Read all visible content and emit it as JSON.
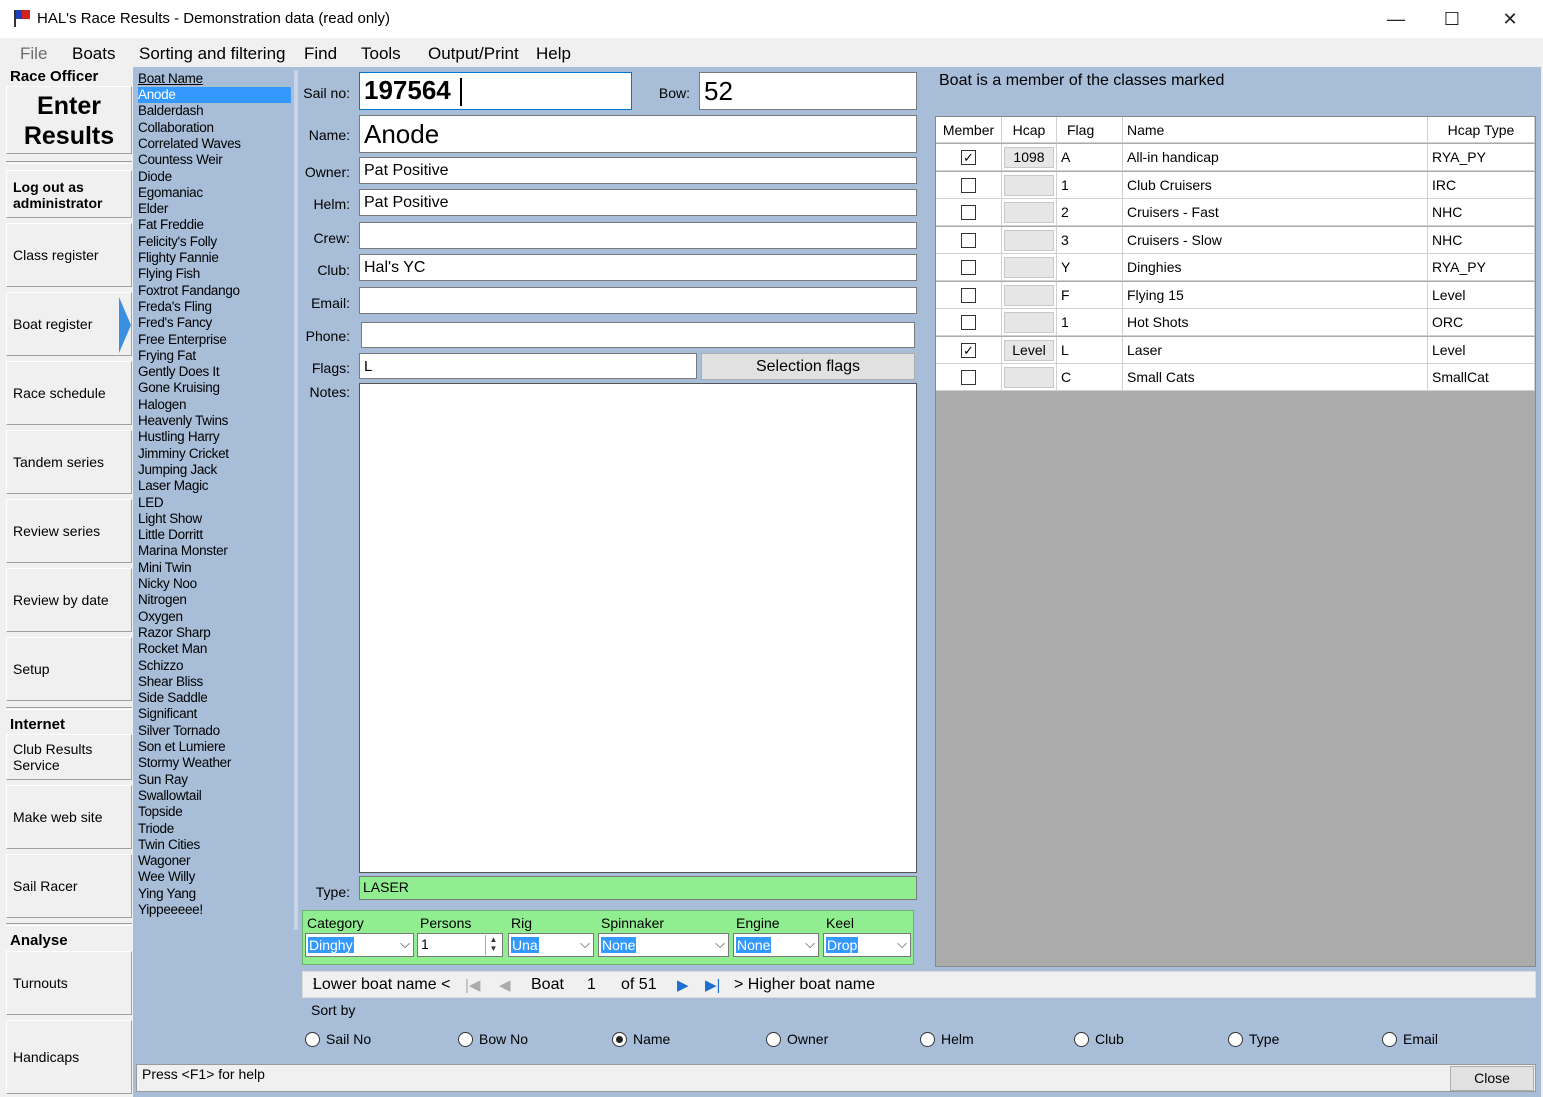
{
  "window": {
    "title": "HAL's Race Results - Demonstration data (read only)",
    "minimize": "—",
    "maximize": "☐",
    "close": "✕"
  },
  "menu": {
    "file": "File",
    "boats": "Boats",
    "sorting": "Sorting and filtering",
    "find": "Find",
    "tools": "Tools",
    "output": "Output/Print",
    "help": "Help"
  },
  "nav": {
    "race_officer": "Race Officer",
    "enter_results_1": "Enter",
    "enter_results_2": "Results",
    "logout_1": "Log out as",
    "logout_2": "administrator",
    "class_register": "Class register",
    "boat_register": "Boat register",
    "race_schedule": "Race schedule",
    "tandem_series": "Tandem series",
    "review_series": "Review series",
    "review_by_date": "Review by date",
    "setup": "Setup",
    "internet": "Internet",
    "club_results_1": "Club Results",
    "club_results_2": "Service",
    "make_web_site": "Make web site",
    "sail_racer": "Sail Racer",
    "analyse": "Analyse",
    "turnouts": "Turnouts",
    "handicaps": "Handicaps"
  },
  "boat_list": {
    "header": "Boat Name",
    "selected": "Anode",
    "items": [
      "Anode",
      "Balderdash",
      "Collaboration",
      "Correlated Waves",
      "Countess Weir",
      "Diode",
      "Egomaniac",
      "Elder",
      "Fat Freddie",
      "Felicity's Folly",
      "Flighty Fannie",
      "Flying Fish",
      "Foxtrot Fandango",
      "Freda's Fling",
      "Fred's Fancy",
      "Free Enterprise",
      "Frying Fat",
      "Gently Does It",
      "Gone Kruising",
      "Halogen",
      "Heavenly Twins",
      "Hustling Harry",
      "Jimminy Cricket",
      "Jumping Jack",
      "Laser Magic",
      "LED",
      "Light Show",
      "Little Dorritt",
      "Marina Monster",
      "Mini Twin",
      "Nicky Noo",
      "Nitrogen",
      "Oxygen",
      "Razor Sharp",
      "Rocket Man",
      "Schizzo",
      "Shear Bliss",
      "Side Saddle",
      "Significant",
      "Silver Tornado",
      "Son et Lumiere",
      "Stormy Weather",
      "Sun Ray",
      "Swallowtail",
      "Topside",
      "Triode",
      "Twin Cities",
      "Wagoner",
      "Wee Willy",
      "Ying Yang",
      "Yippeeeee!"
    ]
  },
  "form": {
    "sail_no_label": "Sail no:",
    "sail_no": "197564",
    "bow_label": "Bow:",
    "bow": "52",
    "name_label": "Name:",
    "name": "Anode",
    "owner_label": "Owner:",
    "owner": "Pat Positive",
    "helm_label": "Helm:",
    "helm": "Pat Positive",
    "crew_label": "Crew:",
    "crew": "",
    "club_label": "Club:",
    "club": "Hal's YC",
    "email_label": "Email:",
    "email": "",
    "phone_label": "Phone:",
    "phone": "",
    "flags_label": "Flags:",
    "flags": "L",
    "selection_flags": "Selection flags",
    "notes_label": "Notes:",
    "notes": "",
    "type_label": "Type:",
    "type": "LASER"
  },
  "type_panel": {
    "category_label": "Category",
    "category": "Dinghy",
    "persons_label": "Persons",
    "persons": "1",
    "rig_label": "Rig",
    "rig": "Una",
    "spinnaker_label": "Spinnaker",
    "spinnaker": "None",
    "engine_label": "Engine",
    "engine": "None",
    "keel_label": "Keel",
    "keel": "Drop"
  },
  "classes": {
    "title": "Boat is a member of the classes marked",
    "headers": {
      "member": "Member",
      "hcap": "Hcap",
      "flag": "Flag",
      "name": "Name",
      "hcap_type": "Hcap Type"
    },
    "rows": [
      {
        "member": true,
        "hcap": "1098",
        "flag": "A",
        "name": "All-in handicap",
        "hcap_type": "RYA_PY"
      },
      {
        "member": false,
        "hcap": "",
        "flag": "1",
        "name": "Club Cruisers",
        "hcap_type": "IRC"
      },
      {
        "member": false,
        "hcap": "",
        "flag": "2",
        "name": "Cruisers - Fast",
        "hcap_type": "NHC"
      },
      {
        "member": false,
        "hcap": "",
        "flag": "3",
        "name": "Cruisers - Slow",
        "hcap_type": "NHC"
      },
      {
        "member": false,
        "hcap": "",
        "flag": "Y",
        "name": "Dinghies",
        "hcap_type": "RYA_PY"
      },
      {
        "member": false,
        "hcap": "",
        "flag": "F",
        "name": "Flying 15",
        "hcap_type": "Level"
      },
      {
        "member": false,
        "hcap": "",
        "flag": "1",
        "name": "Hot Shots",
        "hcap_type": "ORC"
      },
      {
        "member": true,
        "hcap": "Level",
        "flag": "L",
        "name": "Laser",
        "hcap_type": "Level"
      },
      {
        "member": false,
        "hcap": "",
        "flag": "C",
        "name": "Small Cats",
        "hcap_type": "SmallCat"
      }
    ]
  },
  "navigator": {
    "lower": "Lower boat name <",
    "boat_label": "Boat",
    "position": "1",
    "of": "of 51",
    "higher": "> Higher boat name"
  },
  "sort": {
    "label": "Sort by",
    "selected": "Name",
    "options": [
      "Sail No",
      "Bow No",
      "Name",
      "Owner",
      "Helm",
      "Club",
      "Type",
      "Email"
    ]
  },
  "status": {
    "text": "Press <F1> for help",
    "close": "Close"
  }
}
